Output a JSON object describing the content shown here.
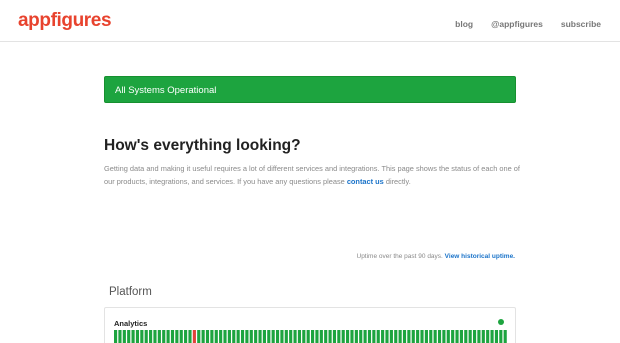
{
  "header": {
    "logo_text": "appfigures",
    "nav": [
      {
        "label": "blog"
      },
      {
        "label": "@appfigures"
      },
      {
        "label": "subscribe"
      }
    ]
  },
  "status": {
    "text": "All Systems Operational",
    "color": "#1da43f"
  },
  "about": {
    "title": "How's everything looking?",
    "text_before_link": "Getting data and making it useful requires a lot of different services and integrations. This page shows the status of each one of our products, integrations, and services. If you have any questions please ",
    "link_text": "contact us",
    "text_after_link": " directly."
  },
  "uptime": {
    "note": "Uptime over the past 90 days.",
    "link": "View historical uptime."
  },
  "group": {
    "title": "Platform",
    "components": [
      {
        "name": "Analytics",
        "status_color": "#1da43f",
        "bar_colors": {
          "ok": "#1da43f",
          "outage": "#e0443a"
        },
        "days": 90,
        "outage_days": [
          18
        ]
      }
    ]
  }
}
